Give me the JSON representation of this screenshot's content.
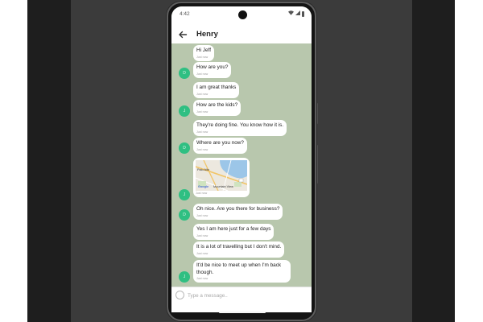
{
  "status_bar": {
    "time": "4:42",
    "icons": [
      "wifi-icon",
      "signal-icon",
      "battery-icon"
    ]
  },
  "header": {
    "back_icon": "arrow-left-icon",
    "title": "Henry"
  },
  "messages": [
    {
      "text": "Hi Jeff",
      "time": "Just now"
    },
    {
      "text": "How are you?",
      "time": "Just now",
      "avatar": "D"
    },
    {
      "text": "I am great thanks",
      "time": "Just now"
    },
    {
      "text": "How are the kids?",
      "time": "Just now",
      "avatar": "J"
    },
    {
      "text": "They're doing fine. You know how it is.",
      "time": "Just now"
    },
    {
      "text": "Where are you now?",
      "time": "Just now",
      "avatar": "D"
    },
    {
      "type": "map",
      "time": "Just now",
      "avatar": "J",
      "map_labels": [
        "Palo Alto",
        "Google",
        "Mountain View"
      ]
    },
    {
      "text": "Oh nice. Are you there for business?",
      "time": "Just now",
      "avatar": "D"
    },
    {
      "text": "Yes I am here just for a few days",
      "time": "Just now"
    },
    {
      "text": "It is a lot of travelling but I don't mind.",
      "time": "Just now"
    },
    {
      "text": "It'd be nice to meet up when I'm back though.",
      "time": "Just now",
      "avatar": "J"
    }
  ],
  "composer": {
    "placeholder": "Type a message..",
    "value": "",
    "icon": "emoji-icon"
  },
  "colors": {
    "chat_background": "#b8c7ad",
    "avatar": "#2fbf82",
    "bubble": "#ffffff",
    "phone_frame": "#141414",
    "backdrop": "#1e1e1e"
  }
}
